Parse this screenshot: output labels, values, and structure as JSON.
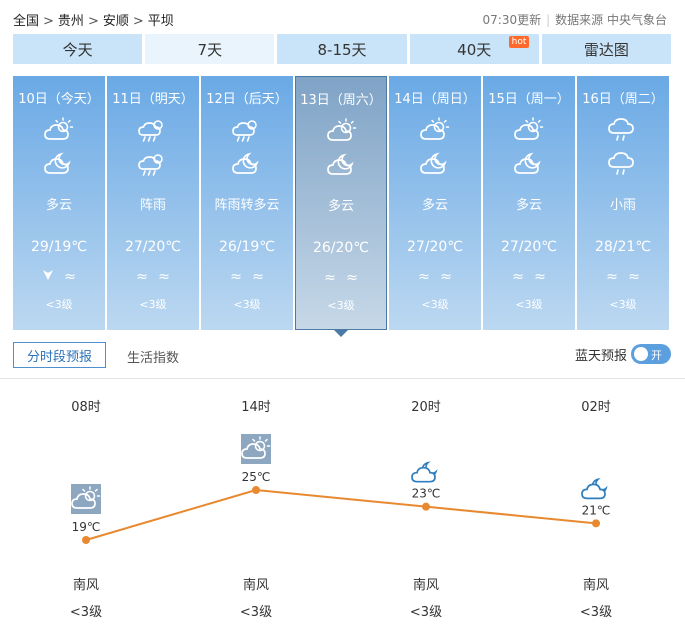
{
  "breadcrumb": [
    "全国",
    "贵州",
    "安顺",
    "平坝"
  ],
  "update_time": "07:30更新",
  "source": "数据来源 中央气象台",
  "tabs": [
    {
      "label": "今天"
    },
    {
      "label": "7天"
    },
    {
      "label": "8-15天"
    },
    {
      "label": "40天",
      "badge": "hot"
    },
    {
      "label": "雷达图"
    }
  ],
  "days": [
    {
      "date": "10日（今天）",
      "icons": [
        "partly-cloudy-day-icon",
        "partly-cloudy-night-icon"
      ],
      "condition": "多云",
      "temp": "29/19℃",
      "wind": [
        "wind-direction-arrow-icon",
        "≈"
      ],
      "level": "<3级"
    },
    {
      "date": "11日（明天）",
      "icons": [
        "shower-rain-icon",
        "shower-rain-icon"
      ],
      "condition": "阵雨",
      "temp": "27/20℃",
      "wind": [
        "≈",
        "≈"
      ],
      "level": "<3级"
    },
    {
      "date": "12日（后天）",
      "icons": [
        "shower-rain-icon",
        "partly-cloudy-night-icon"
      ],
      "condition": "阵雨转多云",
      "temp": "26/19℃",
      "wind": [
        "≈",
        "≈"
      ],
      "level": "<3级"
    },
    {
      "date": "13日（周六）",
      "icons": [
        "partly-cloudy-day-icon",
        "partly-cloudy-night-icon"
      ],
      "condition": "多云",
      "temp": "26/20℃",
      "wind": [
        "≈",
        "≈"
      ],
      "level": "<3级"
    },
    {
      "date": "14日（周日）",
      "icons": [
        "partly-cloudy-day-icon",
        "partly-cloudy-night-icon"
      ],
      "condition": "多云",
      "temp": "27/20℃",
      "wind": [
        "≈",
        "≈"
      ],
      "level": "<3级"
    },
    {
      "date": "15日（周一）",
      "icons": [
        "partly-cloudy-day-icon",
        "partly-cloudy-night-icon"
      ],
      "condition": "多云",
      "temp": "27/20℃",
      "wind": [
        "≈",
        "≈"
      ],
      "level": "<3级"
    },
    {
      "date": "16日（周二）",
      "icons": [
        "light-rain-icon",
        "light-rain-icon"
      ],
      "condition": "小雨",
      "temp": "28/21℃",
      "wind": [
        "≈",
        "≈"
      ],
      "level": "<3级"
    }
  ],
  "subtabs": {
    "hourly": "分时段预报",
    "life": "生活指数"
  },
  "bluesky": {
    "label": "蓝天预报",
    "toggle": "开"
  },
  "hourly": [
    {
      "time": "08时",
      "temp": "19℃",
      "value": 19,
      "icon": "partly-cloudy-day-icon",
      "wind_dir": "南风",
      "wind_level": "<3级"
    },
    {
      "time": "14时",
      "temp": "25℃",
      "value": 25,
      "icon": "partly-cloudy-day-icon",
      "wind_dir": "南风",
      "wind_level": "<3级"
    },
    {
      "time": "20时",
      "temp": "23℃",
      "value": 23,
      "icon": "partly-cloudy-night-icon",
      "wind_dir": "南风",
      "wind_level": "<3级"
    },
    {
      "time": "02时",
      "temp": "21℃",
      "value": 21,
      "icon": "partly-cloudy-night-icon",
      "wind_dir": "南风",
      "wind_level": "<3级"
    }
  ],
  "colors": {
    "tab_bg": "#c9e4f8",
    "tab_active_bg": "#eaf4fc",
    "card_top": "#6aa9e5",
    "card_bottom": "#bcd8f1",
    "selected_top": "#7fa3c6",
    "selected_border": "#4b7aa6",
    "line": "#e8892f",
    "night_icon": "#2f7fbf",
    "hot_badge": "#ff6a2a"
  }
}
